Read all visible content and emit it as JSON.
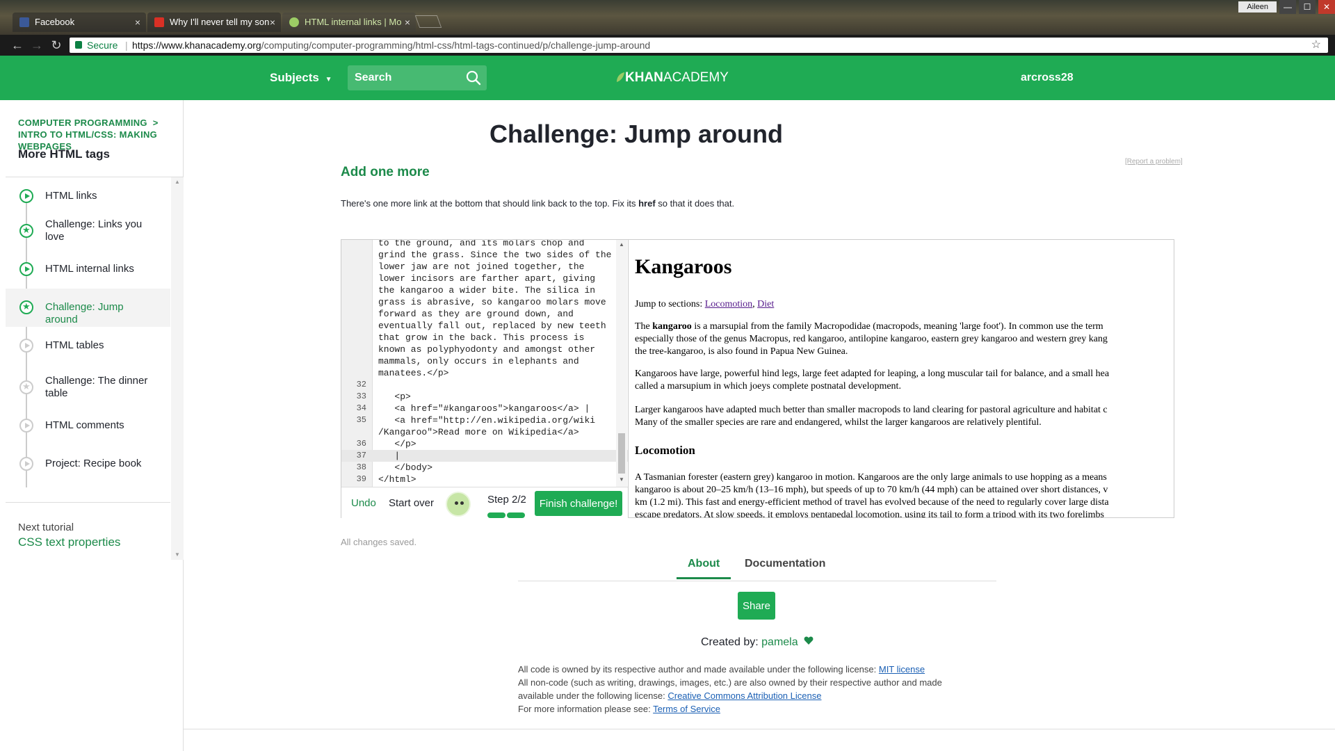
{
  "browser": {
    "tabs": [
      {
        "label": "Facebook",
        "favicon_color": "#3b5998"
      },
      {
        "label": "Why I'll never tell my son",
        "favicon_color": "#d93025"
      },
      {
        "label": "HTML internal links | Mo",
        "favicon_color": "#9ccc65"
      }
    ],
    "close_glyph": "×",
    "window_user": "Aileen",
    "window_controls": [
      "—",
      "☐",
      "✕"
    ],
    "secure_label": "Secure",
    "url_host": "https://www.khanacademy.org",
    "url_path": "/computing/computer-programming/html-css/html-tags-continued/p/challenge-jump-around",
    "nav_icons": [
      "back-arrow-icon",
      "forward-arrow-icon",
      "reload-icon",
      "star-icon"
    ]
  },
  "header": {
    "subjects_label": "Subjects",
    "search_placeholder": "Search",
    "logo_bold": "KHAN",
    "logo_rest": "ACADEMY",
    "username": "arcross28",
    "brand_color": "#1fab54"
  },
  "sidebar": {
    "breadcrumb_1": "COMPUTER PROGRAMMING",
    "breadcrumb_sep": ">",
    "breadcrumb_2": "INTRO TO HTML/CSS: MAKING WEBPAGES",
    "title": "More HTML tags",
    "items": [
      {
        "label": "HTML links",
        "kind": "video",
        "done": true
      },
      {
        "label": "Challenge: Links you love",
        "kind": "challenge",
        "done": true
      },
      {
        "label": "HTML internal links",
        "kind": "video",
        "done": true
      },
      {
        "label": "Challenge: Jump around",
        "kind": "challenge",
        "done": true,
        "active": true
      },
      {
        "label": "HTML tables",
        "kind": "video",
        "done": false
      },
      {
        "label": "Challenge: The dinner table",
        "kind": "challenge",
        "done": false
      },
      {
        "label": "HTML comments",
        "kind": "video",
        "done": false
      },
      {
        "label": "Project: Recipe book",
        "kind": "project",
        "done": false
      }
    ],
    "next_label": "Next tutorial",
    "next_link": "CSS text properties"
  },
  "main": {
    "title": "Challenge: Jump around",
    "report": "[Report a problem]",
    "step_heading": "Add one more",
    "instructions_pre": "There's one more link at the bottom that should link back to the top. Fix its ",
    "instructions_bold": "href",
    "instructions_post": " so that it does that.",
    "saved": "All changes saved."
  },
  "editor": {
    "lines": [
      {
        "num": "",
        "text": "to the ground, and its molars chop and"
      },
      {
        "num": "",
        "text": "grind the grass. Since the two sides of the"
      },
      {
        "num": "",
        "text": "lower jaw are not joined together, the"
      },
      {
        "num": "",
        "text": "lower incisors are farther apart, giving"
      },
      {
        "num": "",
        "text": "the kangaroo a wider bite. The silica in"
      },
      {
        "num": "",
        "text": "grass is abrasive, so kangaroo molars move"
      },
      {
        "num": "",
        "text": "forward as they are ground down, and"
      },
      {
        "num": "",
        "text": "eventually fall out, replaced by new teeth"
      },
      {
        "num": "",
        "text": "that grow in the back. This process is"
      },
      {
        "num": "",
        "text": "known as polyphyodonty and amongst other"
      },
      {
        "num": "",
        "text": "mammals, only occurs in elephants and"
      },
      {
        "num": "",
        "text": "manatees.</p>"
      },
      {
        "num": "32",
        "text": ""
      },
      {
        "num": "33",
        "text": "   <p>"
      },
      {
        "num": "34",
        "text": "   <a href=\"#kangaroos\">kangaroos</a> |"
      },
      {
        "num": "35",
        "text": "   <a href=\"http://en.wikipedia.org/wiki"
      },
      {
        "num": "",
        "text": "/Kangaroo\">Read more on Wikipedia</a>"
      },
      {
        "num": "36",
        "text": "   </p>"
      },
      {
        "num": "37",
        "text": "   |",
        "highlight": true
      },
      {
        "num": "38",
        "text": "   </body>"
      },
      {
        "num": "39",
        "text": "</html>"
      }
    ],
    "undo": "Undo",
    "start_over": "Start over",
    "step": "Step 2/2",
    "steps_completed": 2,
    "steps_total": 2,
    "finish": "Finish challenge!"
  },
  "preview": {
    "heading": "Kangaroos",
    "jump_prefix": "Jump to sections: ",
    "jump_link_1": "Locomotion",
    "jump_comma": ", ",
    "jump_link_2": "Diet",
    "p1_pre": "The ",
    "p1_bold": "kangaroo",
    "p1_line1": " is a marsupial from the family Macropodidae (macropods, meaning 'large foot'). In common use the term",
    "p1_line2": "especially those of the genus Macropus, red kangaroo, antilopine kangaroo, eastern grey kangaroo and western grey kang",
    "p1_line3": "the tree-kangaroo, is also found in Papua New Guinea.",
    "p2_line1": "Kangaroos have large, powerful hind legs, large feet adapted for leaping, a long muscular tail for balance, and a small hea",
    "p2_line2": "called a marsupium in which joeys complete postnatal development.",
    "p3_line1": "Larger kangaroos have adapted much better than smaller macropods to land clearing for pastoral agriculture and habitat c",
    "p3_line2": "Many of the smaller species are rare and endangered, whilst the larger kangaroos are relatively plentiful.",
    "h2": "Locomotion",
    "p4_line1": "A Tasmanian forester (eastern grey) kangaroo in motion. Kangaroos are the only large animals to use hopping as a means",
    "p4_line2": "kangaroo is about 20–25 km/h (13–16 mph), but speeds of up to 70 km/h (44 mph) can be attained over short distances, v",
    "p4_line3": "km (1.2 mi). This fast and energy-efficient method of travel has evolved because of the need to regularly cover large dista",
    "p4_line4": "escape predators. At slow speeds, it employs pentapedal locomotion, using its tail to form a tripod with its two forelimbs"
  },
  "footer": {
    "tab_about": "About",
    "tab_documentation": "Documentation",
    "share": "Share",
    "created_by": "Created by: ",
    "author": "pamela",
    "license_1": "All code is owned by its respective author and made available under the following license: ",
    "mit": "MIT license",
    "license_2": "All non-code (such as writing, drawings, images, etc.) are also owned by their respective author and made",
    "license_3": "available under the following license: ",
    "cc": "Creative Commons Attribution License",
    "license_4": "For more information please see: ",
    "tos": "Terms of Service"
  }
}
